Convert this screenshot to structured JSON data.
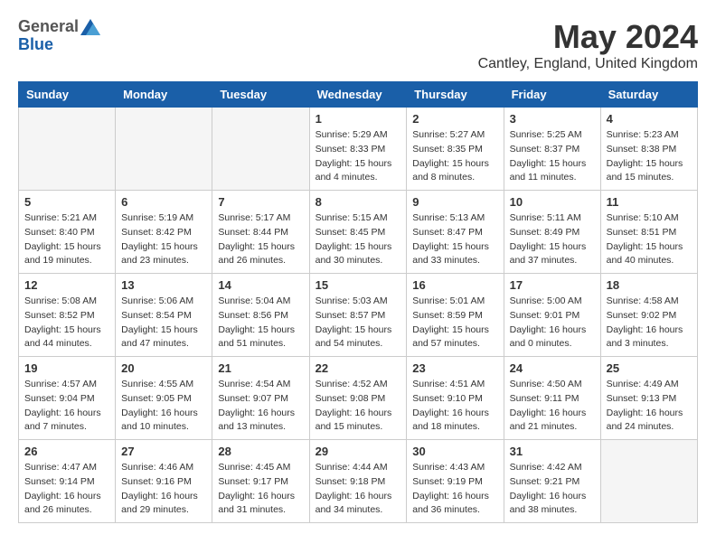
{
  "header": {
    "logo_general": "General",
    "logo_blue": "Blue",
    "month": "May 2024",
    "location": "Cantley, England, United Kingdom"
  },
  "weekdays": [
    "Sunday",
    "Monday",
    "Tuesday",
    "Wednesday",
    "Thursday",
    "Friday",
    "Saturday"
  ],
  "weeks": [
    [
      {
        "day": "",
        "empty": true
      },
      {
        "day": "",
        "empty": true
      },
      {
        "day": "",
        "empty": true
      },
      {
        "day": "1",
        "sunrise": "Sunrise: 5:29 AM",
        "sunset": "Sunset: 8:33 PM",
        "daylight": "Daylight: 15 hours and 4 minutes."
      },
      {
        "day": "2",
        "sunrise": "Sunrise: 5:27 AM",
        "sunset": "Sunset: 8:35 PM",
        "daylight": "Daylight: 15 hours and 8 minutes."
      },
      {
        "day": "3",
        "sunrise": "Sunrise: 5:25 AM",
        "sunset": "Sunset: 8:37 PM",
        "daylight": "Daylight: 15 hours and 11 minutes."
      },
      {
        "day": "4",
        "sunrise": "Sunrise: 5:23 AM",
        "sunset": "Sunset: 8:38 PM",
        "daylight": "Daylight: 15 hours and 15 minutes."
      }
    ],
    [
      {
        "day": "5",
        "sunrise": "Sunrise: 5:21 AM",
        "sunset": "Sunset: 8:40 PM",
        "daylight": "Daylight: 15 hours and 19 minutes."
      },
      {
        "day": "6",
        "sunrise": "Sunrise: 5:19 AM",
        "sunset": "Sunset: 8:42 PM",
        "daylight": "Daylight: 15 hours and 23 minutes."
      },
      {
        "day": "7",
        "sunrise": "Sunrise: 5:17 AM",
        "sunset": "Sunset: 8:44 PM",
        "daylight": "Daylight: 15 hours and 26 minutes."
      },
      {
        "day": "8",
        "sunrise": "Sunrise: 5:15 AM",
        "sunset": "Sunset: 8:45 PM",
        "daylight": "Daylight: 15 hours and 30 minutes."
      },
      {
        "day": "9",
        "sunrise": "Sunrise: 5:13 AM",
        "sunset": "Sunset: 8:47 PM",
        "daylight": "Daylight: 15 hours and 33 minutes."
      },
      {
        "day": "10",
        "sunrise": "Sunrise: 5:11 AM",
        "sunset": "Sunset: 8:49 PM",
        "daylight": "Daylight: 15 hours and 37 minutes."
      },
      {
        "day": "11",
        "sunrise": "Sunrise: 5:10 AM",
        "sunset": "Sunset: 8:51 PM",
        "daylight": "Daylight: 15 hours and 40 minutes."
      }
    ],
    [
      {
        "day": "12",
        "sunrise": "Sunrise: 5:08 AM",
        "sunset": "Sunset: 8:52 PM",
        "daylight": "Daylight: 15 hours and 44 minutes."
      },
      {
        "day": "13",
        "sunrise": "Sunrise: 5:06 AM",
        "sunset": "Sunset: 8:54 PM",
        "daylight": "Daylight: 15 hours and 47 minutes."
      },
      {
        "day": "14",
        "sunrise": "Sunrise: 5:04 AM",
        "sunset": "Sunset: 8:56 PM",
        "daylight": "Daylight: 15 hours and 51 minutes."
      },
      {
        "day": "15",
        "sunrise": "Sunrise: 5:03 AM",
        "sunset": "Sunset: 8:57 PM",
        "daylight": "Daylight: 15 hours and 54 minutes."
      },
      {
        "day": "16",
        "sunrise": "Sunrise: 5:01 AM",
        "sunset": "Sunset: 8:59 PM",
        "daylight": "Daylight: 15 hours and 57 minutes."
      },
      {
        "day": "17",
        "sunrise": "Sunrise: 5:00 AM",
        "sunset": "Sunset: 9:01 PM",
        "daylight": "Daylight: 16 hours and 0 minutes."
      },
      {
        "day": "18",
        "sunrise": "Sunrise: 4:58 AM",
        "sunset": "Sunset: 9:02 PM",
        "daylight": "Daylight: 16 hours and 3 minutes."
      }
    ],
    [
      {
        "day": "19",
        "sunrise": "Sunrise: 4:57 AM",
        "sunset": "Sunset: 9:04 PM",
        "daylight": "Daylight: 16 hours and 7 minutes."
      },
      {
        "day": "20",
        "sunrise": "Sunrise: 4:55 AM",
        "sunset": "Sunset: 9:05 PM",
        "daylight": "Daylight: 16 hours and 10 minutes."
      },
      {
        "day": "21",
        "sunrise": "Sunrise: 4:54 AM",
        "sunset": "Sunset: 9:07 PM",
        "daylight": "Daylight: 16 hours and 13 minutes."
      },
      {
        "day": "22",
        "sunrise": "Sunrise: 4:52 AM",
        "sunset": "Sunset: 9:08 PM",
        "daylight": "Daylight: 16 hours and 15 minutes."
      },
      {
        "day": "23",
        "sunrise": "Sunrise: 4:51 AM",
        "sunset": "Sunset: 9:10 PM",
        "daylight": "Daylight: 16 hours and 18 minutes."
      },
      {
        "day": "24",
        "sunrise": "Sunrise: 4:50 AM",
        "sunset": "Sunset: 9:11 PM",
        "daylight": "Daylight: 16 hours and 21 minutes."
      },
      {
        "day": "25",
        "sunrise": "Sunrise: 4:49 AM",
        "sunset": "Sunset: 9:13 PM",
        "daylight": "Daylight: 16 hours and 24 minutes."
      }
    ],
    [
      {
        "day": "26",
        "sunrise": "Sunrise: 4:47 AM",
        "sunset": "Sunset: 9:14 PM",
        "daylight": "Daylight: 16 hours and 26 minutes."
      },
      {
        "day": "27",
        "sunrise": "Sunrise: 4:46 AM",
        "sunset": "Sunset: 9:16 PM",
        "daylight": "Daylight: 16 hours and 29 minutes."
      },
      {
        "day": "28",
        "sunrise": "Sunrise: 4:45 AM",
        "sunset": "Sunset: 9:17 PM",
        "daylight": "Daylight: 16 hours and 31 minutes."
      },
      {
        "day": "29",
        "sunrise": "Sunrise: 4:44 AM",
        "sunset": "Sunset: 9:18 PM",
        "daylight": "Daylight: 16 hours and 34 minutes."
      },
      {
        "day": "30",
        "sunrise": "Sunrise: 4:43 AM",
        "sunset": "Sunset: 9:19 PM",
        "daylight": "Daylight: 16 hours and 36 minutes."
      },
      {
        "day": "31",
        "sunrise": "Sunrise: 4:42 AM",
        "sunset": "Sunset: 9:21 PM",
        "daylight": "Daylight: 16 hours and 38 minutes."
      },
      {
        "day": "",
        "empty": true
      }
    ]
  ]
}
